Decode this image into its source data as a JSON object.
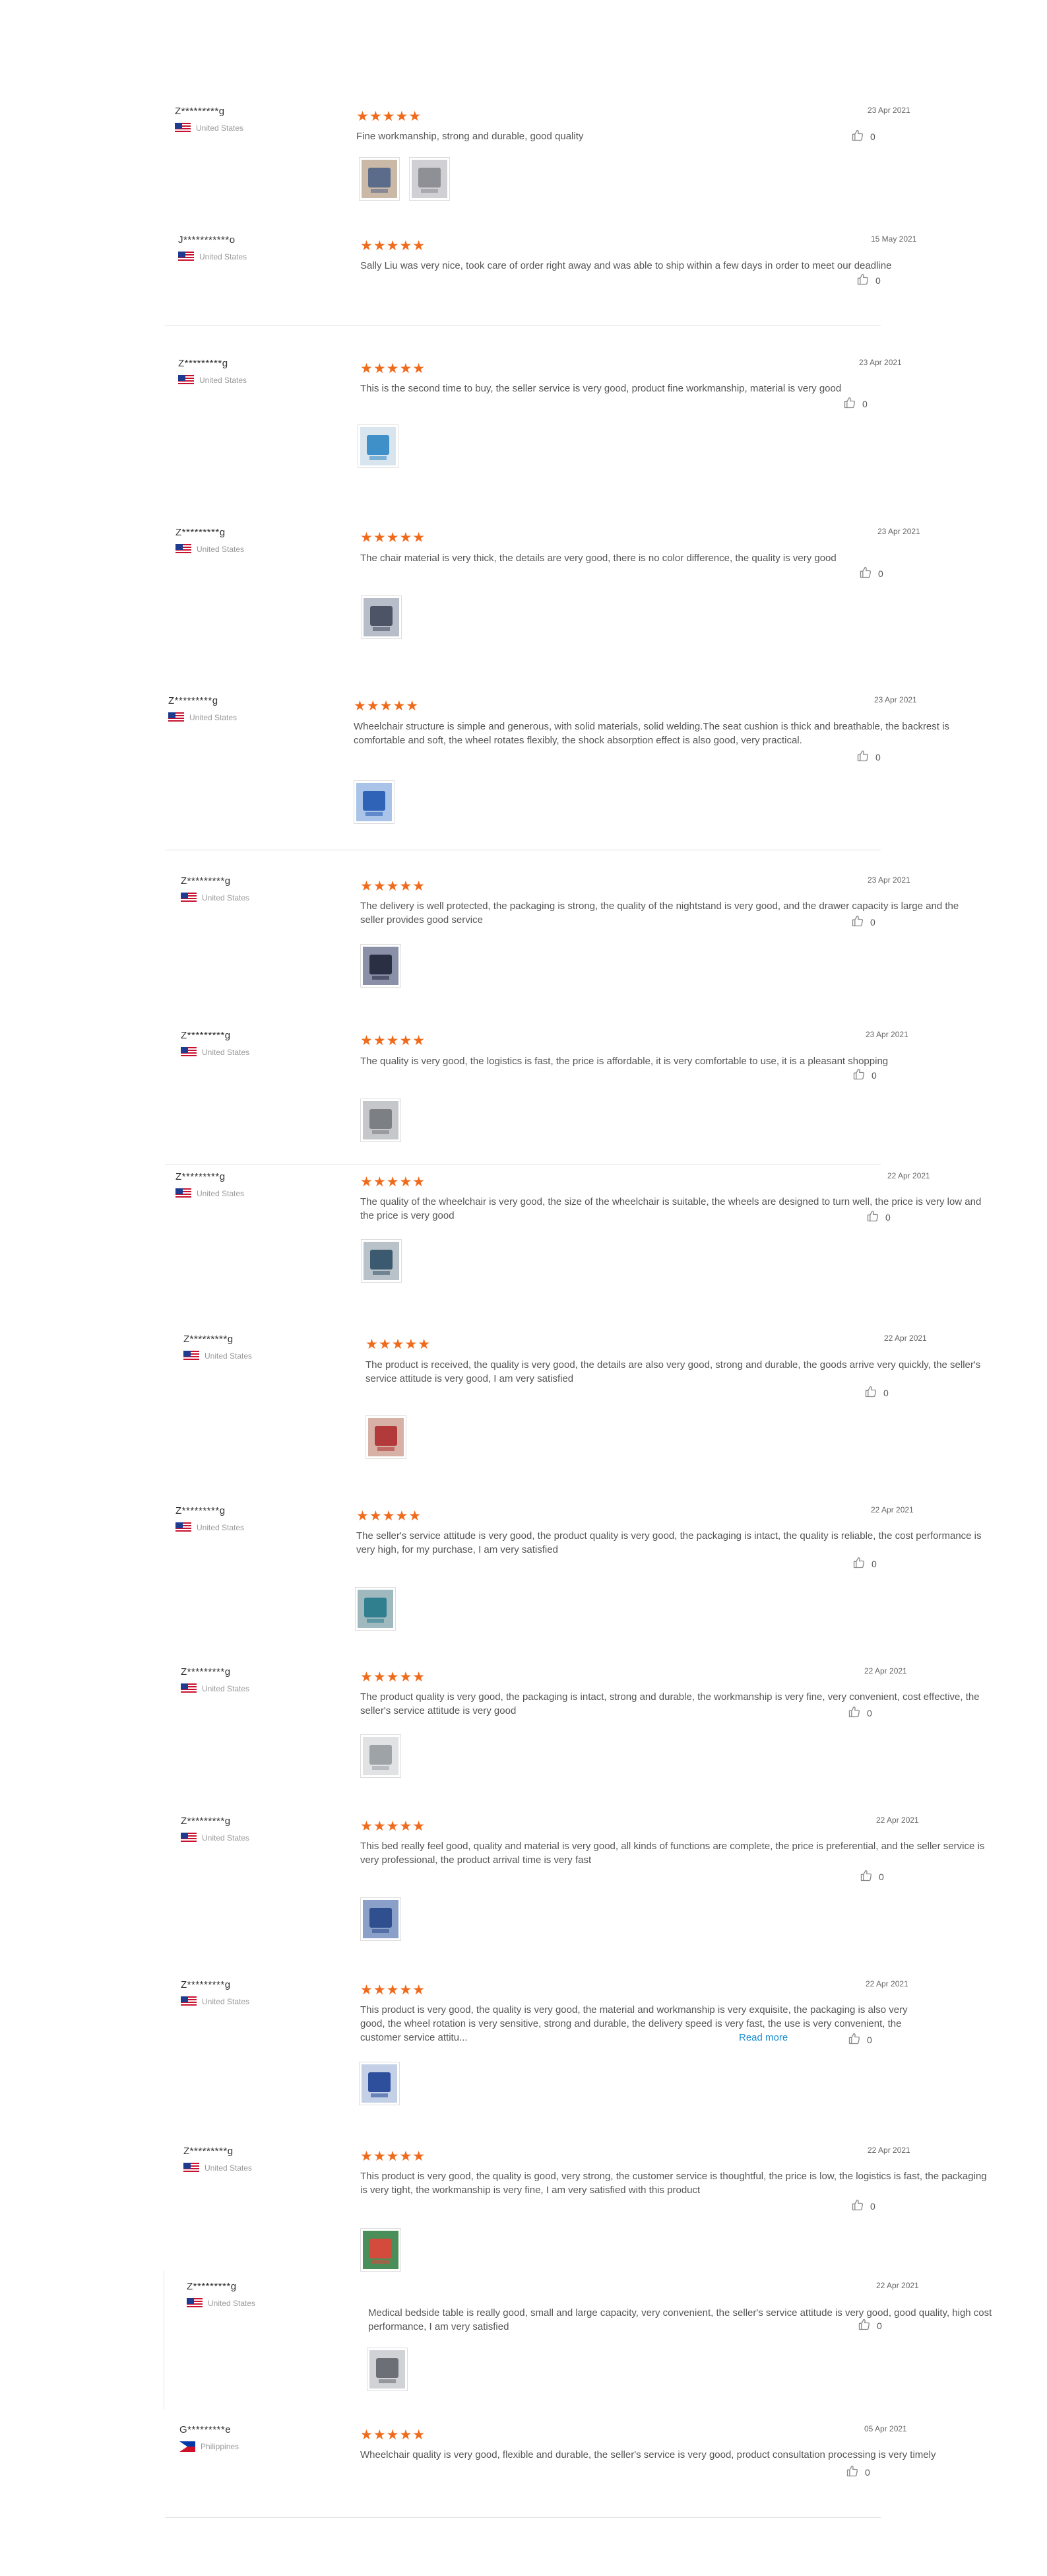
{
  "reviews": [
    {
      "name": "Z*********g",
      "country": "United States",
      "flag": "us",
      "date": "23 Apr 2021",
      "text": "Fine workmanship, strong and durable, good quality",
      "likes": "0",
      "thumbs": [
        "photo-1",
        "photo-2"
      ]
    },
    {
      "name": "J***********o",
      "country": "United States",
      "flag": "us",
      "date": "15 May 2021",
      "text": "Sally Liu was very nice, took care of order right away and was able to ship within a few days in order to meet our deadline",
      "likes": "0",
      "thumbs": []
    },
    {
      "name": "Z*********g",
      "country": "United States",
      "flag": "us",
      "date": "23 Apr 2021",
      "text": "This is the second time to buy, the seller service is very good, product fine workmanship, material is very good",
      "likes": "0",
      "thumbs": [
        "photo-1"
      ]
    },
    {
      "name": "Z*********g",
      "country": "United States",
      "flag": "us",
      "date": "23 Apr 2021",
      "text": "The chair material is very thick, the details are very good, there is no color difference, the quality is very good",
      "likes": "0",
      "thumbs": [
        "photo-1"
      ]
    },
    {
      "name": "Z*********g",
      "country": "United States",
      "flag": "us",
      "date": "23 Apr 2021",
      "text": "Wheelchair structure is simple and generous, with solid materials, solid welding.The seat cushion is thick and breathable, the backrest is comfortable and soft, the wheel rotates flexibly, the shock absorption effect is also good, very practical.",
      "likes": "0",
      "thumbs": [
        "photo-1"
      ]
    },
    {
      "name": "Z*********g",
      "country": "United States",
      "flag": "us",
      "date": "23 Apr 2021",
      "text": "The delivery is well protected, the packaging is strong, the quality of the nightstand is very good, and the drawer capacity is large and the seller provides good service",
      "likes": "0",
      "thumbs": [
        "photo-1"
      ]
    },
    {
      "name": "Z*********g",
      "country": "United States",
      "flag": "us",
      "date": "23 Apr 2021",
      "text": "The quality is very good, the logistics is fast, the price is affordable, it is very comfortable to use, it is a pleasant shopping",
      "likes": "0",
      "thumbs": [
        "photo-1"
      ]
    },
    {
      "name": "Z*********g",
      "country": "United States",
      "flag": "us",
      "date": "22 Apr 2021",
      "text": "The quality of the wheelchair is very good, the size of the wheelchair is suitable, the wheels are designed to turn well, the price is very low and the price is very good",
      "likes": "0",
      "thumbs": [
        "photo-1"
      ]
    },
    {
      "name": "Z*********g",
      "country": "United States",
      "flag": "us",
      "date": "22 Apr 2021",
      "text": "The product is received, the quality is very good, the details are also very good, strong and durable, the goods arrive very quickly, the seller's service attitude is very good, I am very satisfied",
      "likes": "0",
      "thumbs": [
        "photo-1"
      ]
    },
    {
      "name": "Z*********g",
      "country": "United States",
      "flag": "us",
      "date": "22 Apr 2021",
      "text": "The seller's service attitude is very good, the product quality is very good, the packaging is intact, the quality is reliable, the cost performance is very high, for my purchase, I am very satisfied",
      "likes": "0",
      "thumbs": [
        "photo-1"
      ]
    },
    {
      "name": "Z*********g",
      "country": "United States",
      "flag": "us",
      "date": "22 Apr 2021",
      "text": "The product quality is very good, the packaging is intact, strong and durable, the workmanship is very fine, very convenient, cost effective, the seller's service attitude is very good",
      "likes": "0",
      "thumbs": [
        "photo-1"
      ]
    },
    {
      "name": "Z*********g",
      "country": "United States",
      "flag": "us",
      "date": "22 Apr 2021",
      "text": "This bed really feel good, quality and material is very good, all kinds of functions are complete, the price is preferential, and the seller service is very professional, the product arrival time is very fast",
      "likes": "0",
      "thumbs": [
        "photo-1"
      ]
    },
    {
      "name": "Z*********g",
      "country": "United States",
      "flag": "us",
      "date": "22 Apr 2021",
      "text": "This product is very good, the quality is very good, the material and workmanship is very exquisite, the packaging is also very good, the wheel rotation is very sensitive, strong and durable, the delivery speed is very fast, the use is very convenient, the customer service attitu...",
      "more": "Read more",
      "likes": "0",
      "thumbs": [
        "photo-1"
      ]
    },
    {
      "name": "Z*********g",
      "country": "United States",
      "flag": "us",
      "date": "22 Apr 2021",
      "text": "This product is very good, the quality is good, very strong, the customer service is thoughtful, the price is low, the logistics is fast, the packaging is very tight, the workmanship is very fine, I am very satisfied with this product",
      "likes": "0",
      "thumbs": [
        "photo-1"
      ]
    },
    {
      "name": "Z*********g",
      "country": "United States",
      "flag": "us",
      "date": "22 Apr 2021",
      "text": "Medical bedside table is really good, small and large capacity, very convenient, the seller's service attitude is very good, good quality, high cost performance, I am very satisfied",
      "likes": "0",
      "thumbs": [
        "photo-1"
      ]
    },
    {
      "name": "G*********e",
      "country": "Philippines",
      "flag": "ph",
      "date": "05 Apr 2021",
      "text": "Wheelchair quality is very good, flexible and durable, the seller's service is very good, product consultation processing is very timely",
      "likes": "0",
      "thumbs": []
    }
  ],
  "stars_glyph": "★★★★★",
  "colors": {
    "star": "#f06a1b",
    "link": "#1a8ccf",
    "divider": "#e4e4e4"
  }
}
